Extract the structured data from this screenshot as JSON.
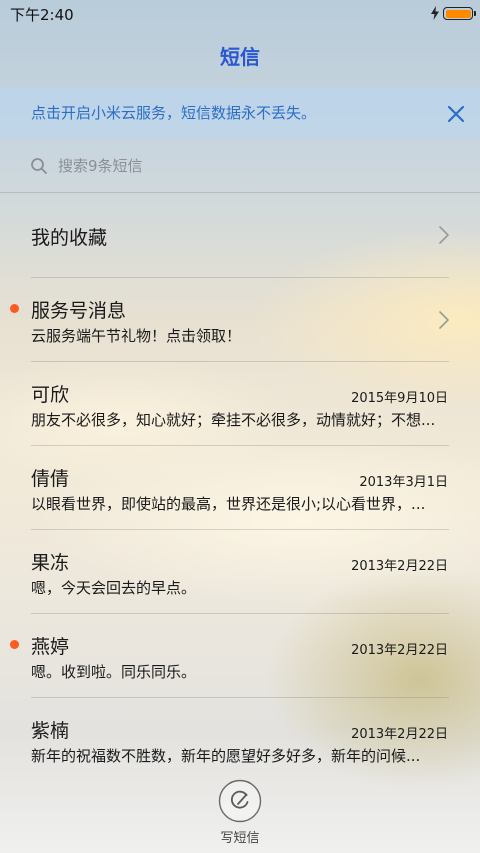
{
  "status_bar": {
    "time": "下午2:40",
    "charging_icon": "lightning-icon",
    "battery_icon": "battery-icon",
    "battery_color": "#ff8a00"
  },
  "header": {
    "title": "短信",
    "title_color": "#2a57d4"
  },
  "banner": {
    "text": "点击开启小米云服务，短信数据永不丢失。",
    "close_icon": "close-icon",
    "text_color": "#2a6ec8"
  },
  "search": {
    "placeholder": "搜索9条短信",
    "value": "",
    "icon": "search-icon"
  },
  "favorites": {
    "label": "我的收藏",
    "icon": "chevron-right-icon"
  },
  "conversations": [
    {
      "name": "服务号消息",
      "date": "",
      "snippet": "云服务端午节礼物！点击领取！",
      "unread": true,
      "chevron": true
    },
    {
      "name": "可欣",
      "date": "2015年9月10日",
      "snippet": "朋友不必很多，知心就好；牵挂不必很多，动情就好；不想...",
      "unread": false,
      "chevron": false
    },
    {
      "name": "倩倩",
      "date": "2013年3月1日",
      "snippet": "以眼看世界，即使站的最高，世界还是很小;以心看世界，...",
      "unread": false,
      "chevron": false
    },
    {
      "name": "果冻",
      "date": "2013年2月22日",
      "snippet": "嗯，今天会回去的早点。",
      "unread": false,
      "chevron": false
    },
    {
      "name": "燕婷",
      "date": "2013年2月22日",
      "snippet": "嗯。收到啦。同乐同乐。",
      "unread": true,
      "chevron": false
    },
    {
      "name": "紫楠",
      "date": "2013年2月22日",
      "snippet": "新年的祝福数不胜数，新年的愿望好多好多，新年的问候...",
      "unread": false,
      "chevron": false
    }
  ],
  "compose": {
    "label": "写短信",
    "icon": "compose-icon"
  },
  "colors": {
    "unread_dot": "#ff5a1f"
  }
}
